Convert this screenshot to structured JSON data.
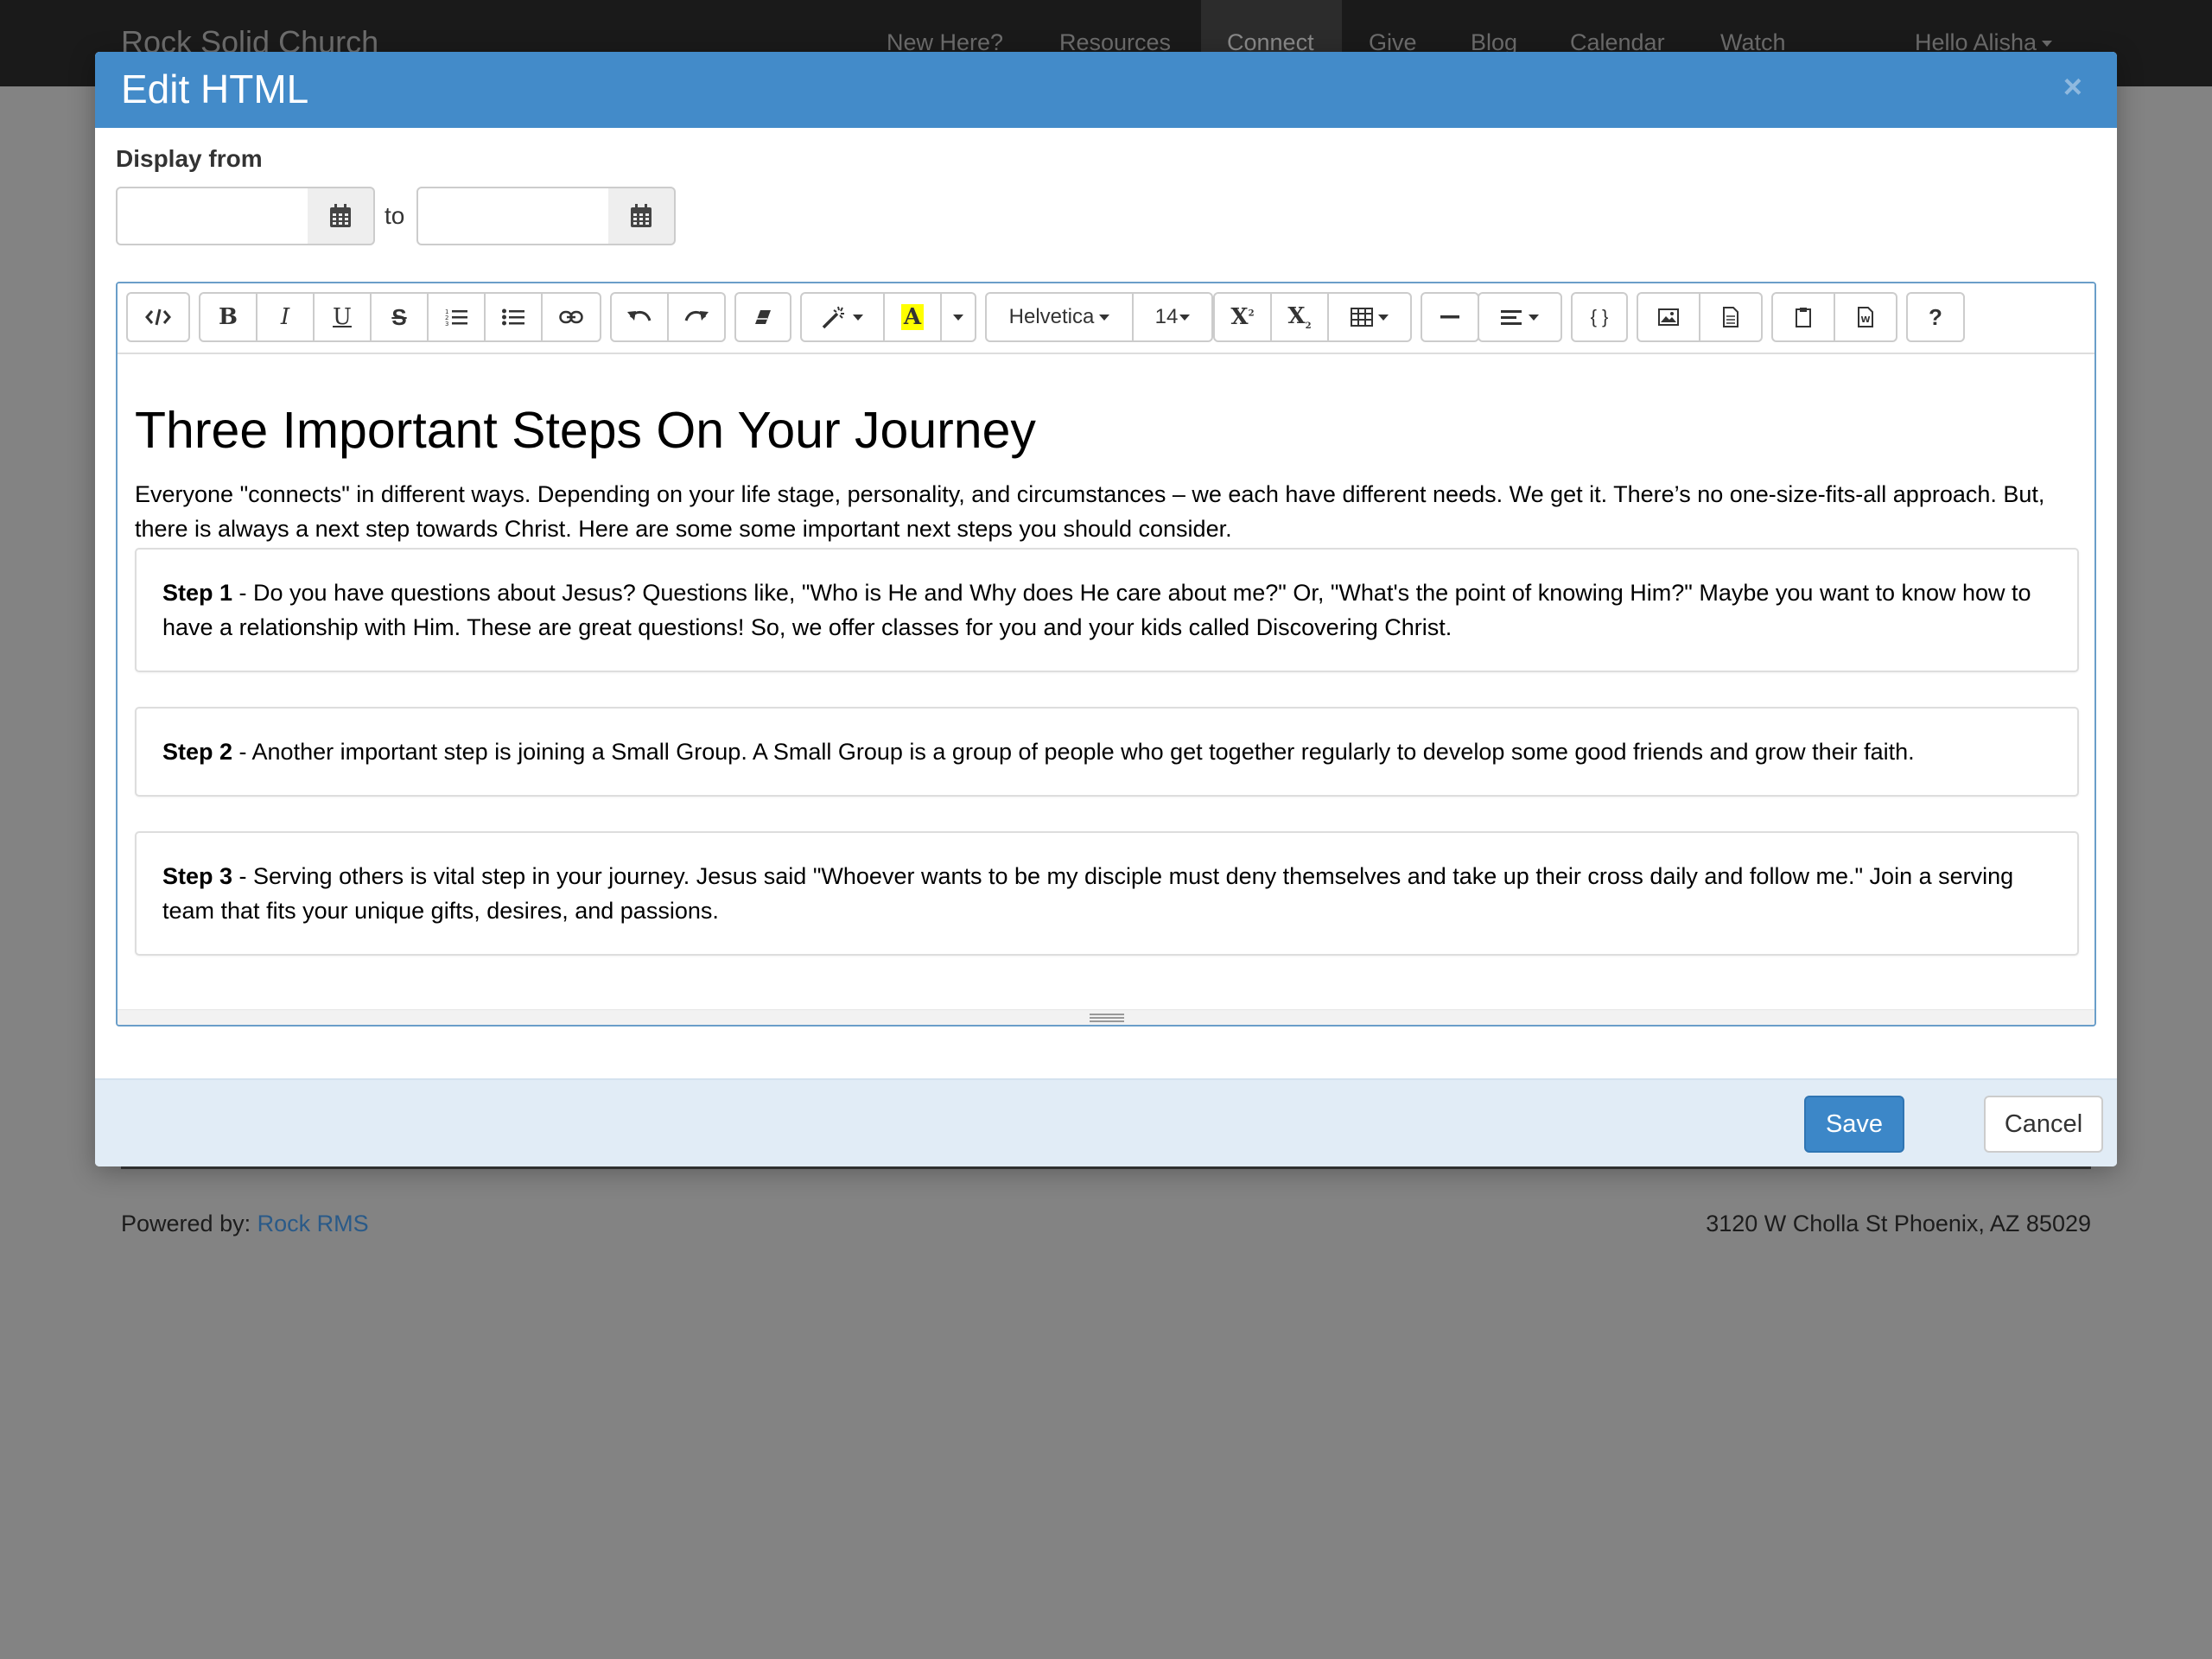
{
  "site": {
    "brand": "Rock Solid Church",
    "nav": [
      "New Here?",
      "Resources",
      "Connect",
      "Give",
      "Blog",
      "Calendar",
      "Watch"
    ],
    "user_menu": "Hello Alisha"
  },
  "footer": {
    "powered_prefix": "Powered by: ",
    "powered_link": "Rock RMS",
    "address": "3120 W Cholla St Phoenix, AZ 85029"
  },
  "modal": {
    "title": "Edit HTML",
    "close": "×",
    "date": {
      "label": "Display from",
      "from_value": "",
      "to_label": "to",
      "to_value": ""
    },
    "toolbar": {
      "font_family": "Helvetica",
      "font_size": "14",
      "help": "?",
      "braces": "{ }"
    },
    "content": {
      "heading": "Three Important Steps On Your Journey",
      "intro": "Everyone \"connects\" in different ways. Depending on your life stage, personality, and circumstances – we each have different needs. We get it. There’s no one-size-fits-all approach. But, there is always a next step towards Christ. Here are some some important next steps you should consider.",
      "steps": [
        {
          "label": "Step 1",
          "text": " - Do you have questions about Jesus? Questions like, \"Who is He and Why does He care about me?\" Or, \"What's the point of knowing Him?\" Maybe you want to know how to have a relationship with Him. These are great questions! So, we offer classes for you and your kids called Discovering Christ."
        },
        {
          "label": "Step 2",
          "text": " - Another important step is joining a Small Group. A Small Group is a group of people who get together regularly to develop some good friends and grow their faith."
        },
        {
          "label": "Step 3",
          "text": " - Serving others is vital step in your journey. Jesus said \"Whoever wants to be my disciple must deny themselves and take up their cross daily and follow me.\" Join a serving team that fits your unique gifts, desires, and passions."
        }
      ]
    },
    "footer": {
      "save": "Save",
      "cancel": "Cancel"
    }
  }
}
